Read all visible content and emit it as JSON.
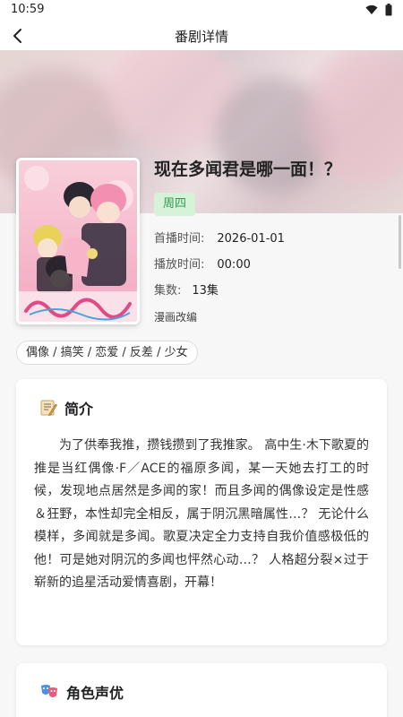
{
  "status_bar": {
    "time": "10:59",
    "icons": [
      "wifi-icon",
      "battery-icon"
    ]
  },
  "nav": {
    "title": "番剧详情",
    "back_icon": "chevron-left-icon"
  },
  "anime": {
    "title": "现在多闻君是哪一面！？",
    "weekday": "周四",
    "premiere_label": "首播时间:",
    "premiere_value": "2026-01-01",
    "airtime_label": "播放时间:",
    "airtime_value": "00:00",
    "episodes_label": "集数:",
    "episodes_value": "13集",
    "source": "漫画改编",
    "tags": "偶像 / 搞笑 / 恋爱 / 反差 / 少女"
  },
  "synopsis_card": {
    "icon": "memo-icon",
    "title": "简介",
    "text": "为了供奉我推，攒钱攒到了我推家。 高中生·木下歌夏的推是当红偶像·F／ACE的福原多闻，某一天她去打工的时候，发现地点居然是多闻的家！而且多闻的偶像设定是性感＆狂野，本性却完全相反，属于阴沉黑暗属性…？ 无论什么模样，多闻就是多闻。歌夏决定全力支持自我价值感极低的他！可是她对阴沉的多闻也怦然心动…？ 人格超分裂×过于崭新的追星活动爱情喜剧，开幕！"
  },
  "cast_card": {
    "icon": "theater-masks-icon",
    "title": "角色声优"
  },
  "colors": {
    "accent_green": "#2e9d4a",
    "badge_bg": "#d6f2d9",
    "page_bg": "#f7f7f7"
  }
}
